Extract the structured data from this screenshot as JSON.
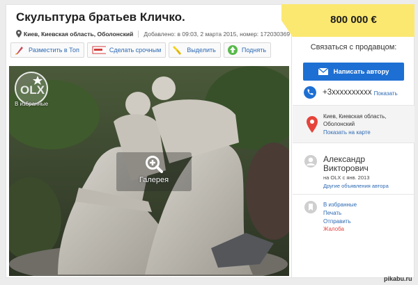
{
  "listing": {
    "title": "Скульптура братьев Кличко.",
    "location": "Киев, Киевская область, Оболонский",
    "added": "Добавлено: в 09:03, 2 марта 2015, номер: 172030369"
  },
  "actions": [
    {
      "label": "Разместить в Топ",
      "icon": "rocket-icon"
    },
    {
      "label": "Сделать срочным",
      "icon": "urgent-sticker-icon"
    },
    {
      "label": "Выделить",
      "icon": "highlighter-icon"
    },
    {
      "label": "Поднять",
      "icon": "arrow-up-icon"
    }
  ],
  "photo": {
    "favorite_label": "В избранные",
    "logo_text": "OLX",
    "gallery_label": "Галерея"
  },
  "price": "800 000 €",
  "contact": {
    "title": "Связаться с продавцом:",
    "write_button": "Написать автору",
    "phone": "+3xxxxxxxxxx",
    "show_phone": "Показать"
  },
  "address": {
    "text": "Киев, Киевская область, Оболонский",
    "map_link": "Показать на карте"
  },
  "seller": {
    "name": "Александр Викторович",
    "since": "на OLX с янв. 2013",
    "other_ads": "Другие объявления автора"
  },
  "sidebar_links": {
    "favorite": "В избранные",
    "print": "Печать",
    "share": "Отправить",
    "complaint": "Жалоба"
  },
  "watermark": "pikabu.ru",
  "colors": {
    "accent_blue": "#1d6fd3",
    "price_yellow": "#fbe870",
    "map_pin_red": "#e6443a",
    "link_blue": "#2d6ab3",
    "complaint_red": "#e04545"
  }
}
